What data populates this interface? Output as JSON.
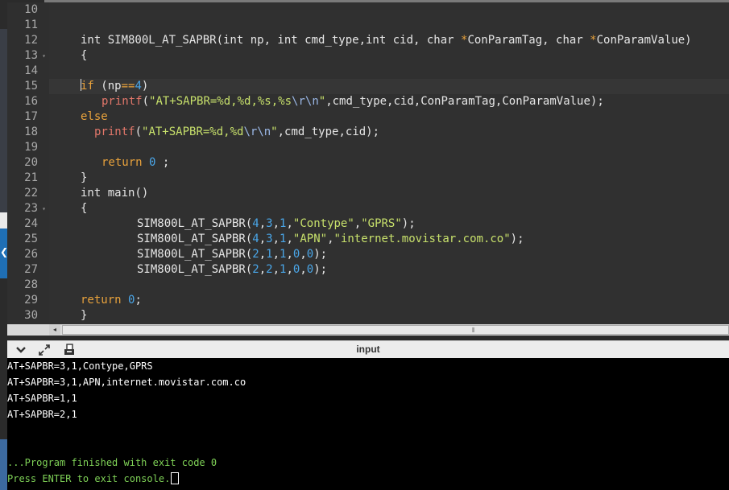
{
  "editor": {
    "line_numbers": [
      "10",
      "11",
      "12",
      "13",
      "14",
      "15",
      "16",
      "17",
      "18",
      "19",
      "20",
      "21",
      "22",
      "23",
      "24",
      "25",
      "26",
      "27",
      "28",
      "29",
      "30"
    ],
    "fold_markers": {
      "13": "▾",
      "23": "▾"
    },
    "lines": {
      "12": {
        "a": "int SIM800L_AT_SAPBR(int np, int cmd_type,int cid, char ",
        "b": "*",
        "c": "ConParamTag, char ",
        "d": "*",
        "e": "ConParamValue)"
      },
      "13": "{",
      "15": {
        "a": "if",
        "b": " (np",
        "c": "==",
        "d": "4",
        "e": ")"
      },
      "16": {
        "a": "printf",
        "b": "(",
        "c": "\"AT+SAPBR=%d,%d,%s,%s",
        "d": "\\r\\n",
        "e": "\"",
        "f": ",cmd_type,cid,ConParamTag,ConParamValue);"
      },
      "17": "else",
      "18": {
        "a": "printf",
        "b": "(",
        "c": "\"AT+SAPBR=%d,%d",
        "d": "\\r\\n",
        "e": "\"",
        "f": ",cmd_type,cid);"
      },
      "20": {
        "a": "return ",
        "b": "0",
        "c": " ;"
      },
      "21": "}",
      "22": "int main()",
      "23": "{",
      "24": {
        "a": "SIM800L_AT_SAPBR(",
        "n1": "4",
        "s1": ",",
        "n2": "3",
        "s2": ",",
        "n3": "1",
        "s3": ",",
        "str1": "\"Contype\"",
        "s4": ",",
        "str2": "\"GPRS\"",
        "end": ");"
      },
      "25": {
        "a": "SIM800L_AT_SAPBR(",
        "n1": "4",
        "s1": ",",
        "n2": "3",
        "s2": ",",
        "n3": "1",
        "s3": ",",
        "str1": "\"APN\"",
        "s4": ",",
        "str2": "\"internet.movistar.com.co\"",
        "end": ");"
      },
      "26": {
        "a": "SIM800L_AT_SAPBR(",
        "n1": "2",
        "s1": ",",
        "n2": "1",
        "s2": ",",
        "n3": "1",
        "s3": ",",
        "n4": "0",
        "s4": ",",
        "n5": "0",
        "end": ");"
      },
      "27": {
        "a": "SIM800L_AT_SAPBR(",
        "n1": "2",
        "s1": ",",
        "n2": "2",
        "s2": ",",
        "n3": "1",
        "s3": ",",
        "n4": "0",
        "s4": ",",
        "n5": "0",
        "end": ");"
      },
      "29": {
        "a": "return ",
        "b": "0",
        "c": ";"
      },
      "30": "}"
    },
    "scroll_grip": "⦀",
    "scroll_left": "◂"
  },
  "console": {
    "title": "input",
    "icons": [
      "chevron-down-icon",
      "expand-icon",
      "copy-icon"
    ],
    "lines": [
      "AT+SAPBR=3,1,Contype,GPRS",
      "AT+SAPBR=3,1,APN,internet.movistar.com.co",
      "AT+SAPBR=1,1",
      "AT+SAPBR=2,1"
    ],
    "finished": "...Program finished with exit code 0",
    "prompt": "Press ENTER to exit console."
  },
  "colors": {
    "editor_bg": "#303030",
    "keyword_number": "#4aa6e8",
    "string": "#c7e06b",
    "function": "#e2776a",
    "operator": "#e8a23c",
    "console_green": "#7fd257"
  }
}
